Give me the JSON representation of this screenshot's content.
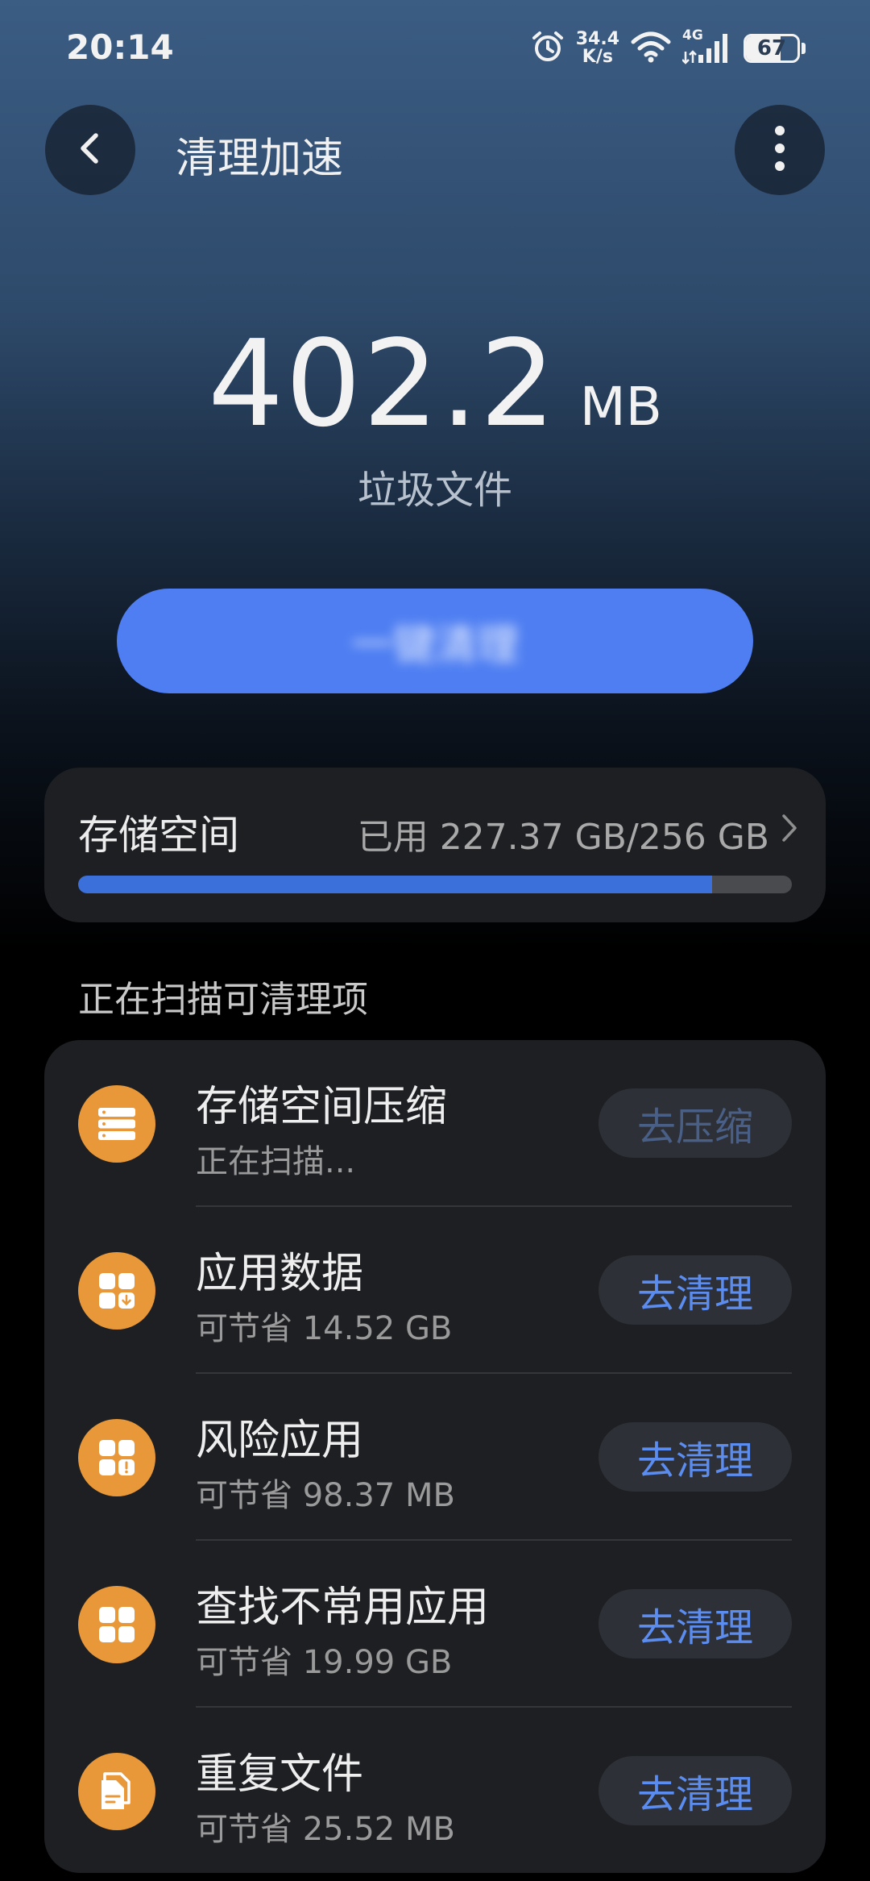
{
  "status_bar": {
    "time": "20:14",
    "net_speed_value": "34.4",
    "net_speed_unit": "K/s",
    "network_type": "4G",
    "battery_level": "67",
    "battery_fraction": 0.67,
    "icons": [
      "alarm-clock-icon",
      "wifi-icon",
      "signal-icon",
      "battery-icon"
    ]
  },
  "header": {
    "title": "清理加速",
    "back_icon": "back-arrow-icon",
    "more_icon": "more-vertical-icon"
  },
  "junk": {
    "size": "402.2",
    "unit": "MB",
    "label": "垃圾文件",
    "button_label": "一键清理"
  },
  "storage": {
    "title": "存储空间",
    "usage": "已用 227.37 GB/256 GB",
    "used_gb": 227.37,
    "total_gb": 256,
    "used_fraction": 0.888
  },
  "scan": {
    "heading": "正在扫描可清理项",
    "items": [
      {
        "title": "存储空间压缩",
        "subtitle": "正在扫描...",
        "action": "去压缩",
        "icon": "storage-list-icon",
        "enabled": false
      },
      {
        "title": "应用数据",
        "subtitle": "可节省 14.52 GB",
        "action": "去清理",
        "icon": "app-data-icon",
        "enabled": true
      },
      {
        "title": "风险应用",
        "subtitle": "可节省 98.37 MB",
        "action": "去清理",
        "icon": "risky-app-icon",
        "enabled": true
      },
      {
        "title": "查找不常用应用",
        "subtitle": "可节省 19.99 GB",
        "action": "去清理",
        "icon": "apps-grid-icon",
        "enabled": true
      },
      {
        "title": "重复文件",
        "subtitle": "可节省 25.52 MB",
        "action": "去清理",
        "icon": "duplicate-file-icon",
        "enabled": true
      }
    ]
  },
  "colors": {
    "accent": "#4e7ef2",
    "icon_orange": "#e89838",
    "card_bg": "#1d1f23",
    "storage_fill": "#3b6fd9"
  }
}
